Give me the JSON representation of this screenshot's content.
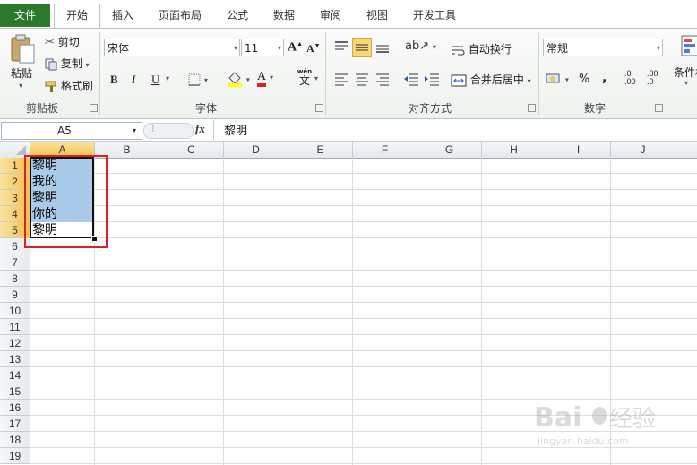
{
  "tabs": [
    "文件",
    "开始",
    "插入",
    "页面布局",
    "公式",
    "数据",
    "审阅",
    "视图",
    "开发工具"
  ],
  "clipboard": {
    "paste": "粘贴",
    "cut": "剪切",
    "copy": "复制",
    "format_painter": "格式刷",
    "group": "剪贴板"
  },
  "font": {
    "name": "宋体",
    "size": "11",
    "group": "字体",
    "bold": "B",
    "italic": "I",
    "underline": "U",
    "font_color_letter": "A",
    "wen": "wén",
    "wen_char": "文"
  },
  "alignment": {
    "wrap": "自动换行",
    "merge": "合并后居中",
    "group": "对齐方式"
  },
  "number": {
    "format": "常规",
    "percent": "%",
    "comma": ",",
    "inc_decimal": ".0",
    "inc_decimal2": ".00",
    "dec_decimal": ".00",
    "dec_decimal2": ".0",
    "group": "数字"
  },
  "styles": {
    "conditional": "条件格"
  },
  "formula_bar": {
    "name_box": "A5",
    "fx": "fx",
    "content": "黎明"
  },
  "columns": [
    "A",
    "B",
    "C",
    "D",
    "E",
    "F",
    "G",
    "H",
    "I",
    "J"
  ],
  "rows": [
    "1",
    "2",
    "3",
    "4",
    "5",
    "6",
    "7",
    "8",
    "9",
    "10",
    "11",
    "12",
    "13",
    "14",
    "15",
    "16",
    "17",
    "18",
    "19"
  ],
  "cells": [
    "黎明",
    "我的",
    "黎明",
    "你的",
    "黎明"
  ],
  "colors": {
    "file_tab": "#2a7a2a",
    "selection": "#a9cbe9",
    "highlight_box": "#e02020",
    "active_header": "#f5c04a"
  },
  "watermark": "Baidu经验 jingyan.baidu.com"
}
